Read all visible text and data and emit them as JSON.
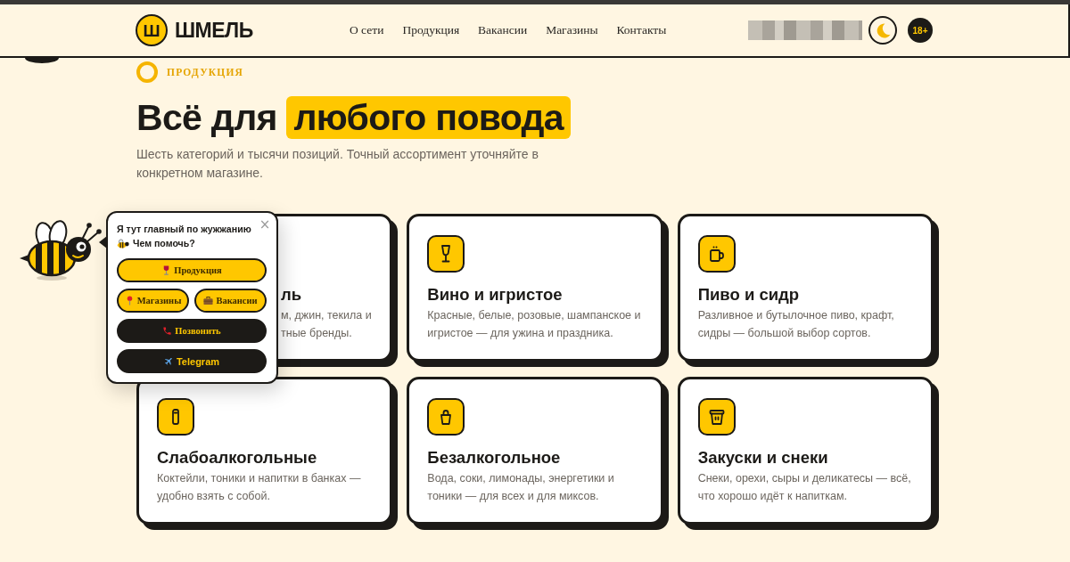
{
  "header": {
    "logo_mark": "Ш",
    "logo_text": "ШМЕЛЬ",
    "nav": [
      "О сети",
      "Продукция",
      "Вакансии",
      "Магазины",
      "Контакты"
    ],
    "age_badge": "18+"
  },
  "section": {
    "label": "ПРОДУКЦИЯ",
    "heading": {
      "text": "Всё для",
      "highlight": "любого повода"
    },
    "subtitle": "Шесть категорий и тысячи позиций. Точный ассортимент уточняйте в конкретном магазине."
  },
  "cards": [
    {
      "kind": "covered",
      "title": "ль",
      "lines": [
        "м, джин, текила и",
        "тные бренды."
      ]
    },
    {
      "kind": "full",
      "title": "Вино и игристое",
      "description": "Красные, белые, розовые, шампанское и игристое — для ужина и праздника."
    },
    {
      "kind": "full",
      "title": "Пиво и сидр",
      "description": "Разливное и бутылочное пиво, крафт, сидры — большой выбор сортов."
    },
    {
      "kind": "full",
      "title": "Слабоалкогольные",
      "description": "Коктейли, тоники и напитки в банках — удобно взять с собой."
    },
    {
      "kind": "full",
      "title": "Безалкогольное",
      "description": "Вода, соки, лимонады, энергетики и тоники — для всех и для миксов."
    },
    {
      "kind": "full",
      "title": "Закуски и снеки",
      "description": "Снеки, орехи, сыры и деликатесы — всё, что хорошо идёт к напиткам."
    }
  ],
  "assistant": {
    "greeting": "Я тут главный по жужжанию",
    "question": "Чем помочь?",
    "close": "×",
    "button_rows": [
      [
        {
          "label": "Продукция",
          "kind": "primary"
        }
      ],
      [
        {
          "label": "Магазины",
          "kind": "primary"
        },
        {
          "label": "Вакансии",
          "kind": "primary"
        }
      ],
      [
        {
          "label": "Позвонить",
          "kind": "dark"
        }
      ],
      [
        {
          "label": "Telegram",
          "kind": "messenger"
        }
      ]
    ]
  }
}
